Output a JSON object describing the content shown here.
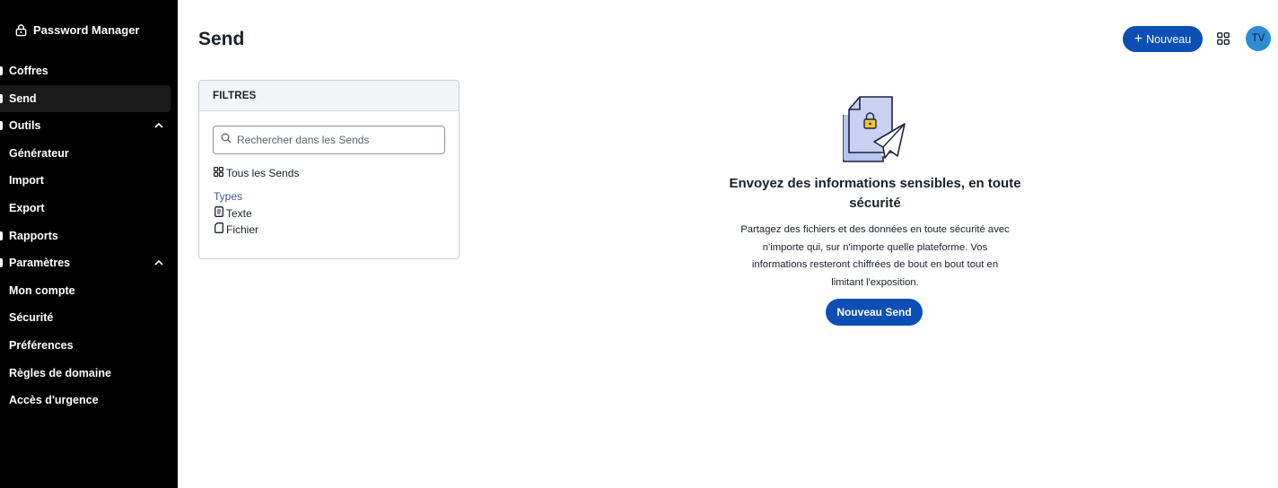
{
  "app": {
    "name": "Password Manager"
  },
  "sidebar": {
    "items": [
      {
        "label": "Coffres"
      },
      {
        "label": "Send"
      },
      {
        "label": "Outils"
      },
      {
        "label": "Générateur"
      },
      {
        "label": "Import"
      },
      {
        "label": "Export"
      },
      {
        "label": "Rapports"
      },
      {
        "label": "Paramètres"
      },
      {
        "label": "Mon compte"
      },
      {
        "label": "Sécurité"
      },
      {
        "label": "Préférences"
      },
      {
        "label": "Règles de domaine"
      },
      {
        "label": "Accès d'urgence"
      }
    ],
    "caret": "^"
  },
  "header": {
    "title": "Send",
    "new_button_label": "Nouveau",
    "avatar_initials": "TV"
  },
  "filters": {
    "title": "FILTRES",
    "search_placeholder": "Rechercher dans les Sends",
    "all_label": "Tous les Sends",
    "types_label": "Types",
    "types": [
      {
        "label": "Texte"
      },
      {
        "label": "Fichier"
      }
    ]
  },
  "empty_state": {
    "title": "Envoyez des informations sensibles, en toute sécurité",
    "description": "Partagez des fichiers et des données en toute sécurité avec n'importe qui, sur n'importe quelle plateforme. Vos informations resteront chiffrées de bout en bout tout en limitant l'exposition.",
    "button_label": "Nouveau Send"
  },
  "colors": {
    "sidebar_bg": "#000000",
    "primary": "#0b4fb5",
    "avatar": "#2e8bd6"
  }
}
